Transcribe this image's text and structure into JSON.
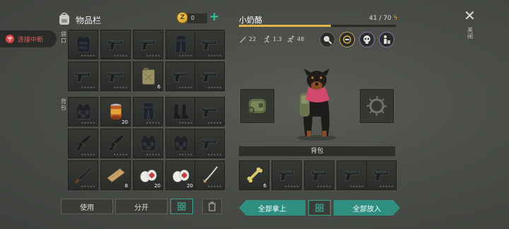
{
  "connection": {
    "status_label": "连接中断"
  },
  "inventory": {
    "title": "物品栏",
    "side_label_top": "袋口",
    "side_label_backpack": "背包",
    "coins": "0",
    "rows": [
      [
        {
          "icon": "body-armor-icon"
        },
        {
          "icon": "pistol-icon"
        },
        {
          "icon": "pistol-icon"
        },
        {
          "icon": "armor-leggings-icon"
        },
        {
          "icon": "pistol-icon"
        }
      ],
      [
        {
          "icon": "pistol-icon"
        },
        {
          "icon": "pistol-icon"
        },
        {
          "icon": "jerrycan-icon",
          "qty": "6"
        },
        {
          "icon": "pistol-icon"
        },
        {
          "icon": "pistol-icon"
        }
      ],
      [
        {
          "icon": "tactical-vest-icon"
        },
        {
          "icon": "canned-food-icon",
          "qty": "20"
        },
        {
          "icon": "armor-leggings-icon"
        },
        {
          "icon": "boots-icon"
        },
        {
          "icon": "pistol-icon"
        }
      ],
      [
        {
          "icon": "assault-rifle-icon"
        },
        {
          "icon": "assault-rifle-icon"
        },
        {
          "icon": "tactical-vest-icon"
        },
        {
          "icon": "tactical-vest-icon"
        },
        {
          "icon": "pistol-icon"
        }
      ],
      [
        {
          "icon": "shotgun-icon"
        },
        {
          "icon": "wood-plank-icon",
          "qty": "8"
        },
        {
          "icon": "bandage-icon",
          "qty": "20"
        },
        {
          "icon": "bandage-icon",
          "qty": "20"
        },
        {
          "icon": "katana-icon"
        }
      ]
    ],
    "use_label": "使用",
    "split_label": "分开"
  },
  "pet": {
    "name": "小奶酪",
    "hp": "41 / 70",
    "hp_fraction": 0.586,
    "stats": {
      "attack": "22",
      "speed": "1.3",
      "run": "48"
    },
    "backpack_label": "背包",
    "backpack_items": [
      {
        "icon": "bone-icon",
        "qty": "6"
      },
      {
        "icon": "pistol-icon"
      },
      {
        "icon": "pistol-icon"
      },
      {
        "icon": "pistol-icon"
      },
      {
        "icon": "pistol-icon"
      }
    ],
    "take_all_label": "全部拿上",
    "put_all_label": "全部放入"
  },
  "close_label": "关闭",
  "colors": {
    "accent": "#2e8e7f",
    "hp_bar": "#e3b34a",
    "coin": "#e2b23d",
    "alert": "#d84646"
  }
}
